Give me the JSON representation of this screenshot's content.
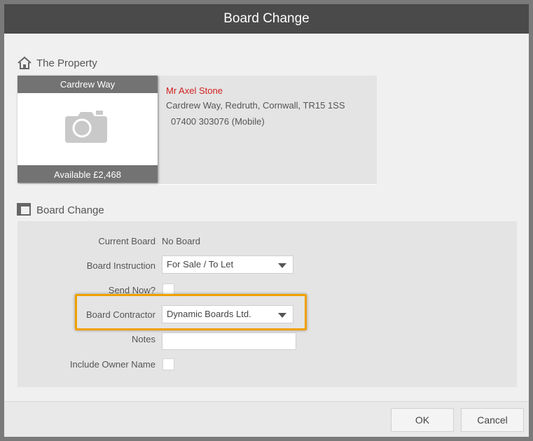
{
  "dialog": {
    "title": "Board Change"
  },
  "property_section": {
    "heading": "The Property",
    "card_title": "Cardrew Way",
    "card_status": "Available £2,468",
    "owner_name": "Mr Axel Stone",
    "address": "Cardrew Way, Redruth, Cornwall, TR15 1SS",
    "phone": "07400 303076 (Mobile)",
    "owner_color": "#d21f1f"
  },
  "board_section": {
    "heading": "Board Change",
    "current_board_label": "Current Board",
    "current_board_value": "No Board",
    "instruction_label": "Board Instruction",
    "instruction_value": "For Sale / To Let",
    "send_now_label": "Send Now?",
    "send_now_checked": false,
    "contractor_label": "Board Contractor",
    "contractor_value": "Dynamic Boards Ltd.",
    "notes_label": "Notes",
    "notes_value": "",
    "include_owner_label": "Include Owner Name",
    "include_owner_checked": false,
    "highlight_color": "#f0a000"
  },
  "footer": {
    "ok_label": "OK",
    "cancel_label": "Cancel"
  },
  "icons": [
    "home-icon",
    "camera-icon",
    "document-icon",
    "chevron-down-icon"
  ]
}
